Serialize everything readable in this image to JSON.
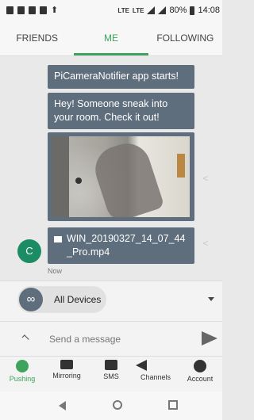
{
  "status_bar": {
    "lte1": "LTE",
    "lte2": "LTE",
    "battery": "80%",
    "time": "14:08"
  },
  "tabs": [
    {
      "label": "FRIENDS",
      "active": false
    },
    {
      "label": "ME",
      "active": true
    },
    {
      "label": "FOLLOWING",
      "active": false
    }
  ],
  "chat": {
    "messages": [
      {
        "text": "PiCameraNotifier app starts!"
      },
      {
        "text": "Hey! Someone sneak into your room. Check it out!"
      },
      {
        "text": ""
      },
      {
        "text": "WIN_20190327_14_07_44_Pro.mp4"
      }
    ],
    "avatar_letter": "C",
    "timestamp": "Now"
  },
  "devices": {
    "label": "All Devices"
  },
  "composer": {
    "placeholder": "Send a message"
  },
  "bottom_nav": [
    {
      "label": "Pushing",
      "active": true
    },
    {
      "label": "Mirroring",
      "active": false
    },
    {
      "label": "SMS",
      "active": false
    },
    {
      "label": "Channels",
      "active": false
    },
    {
      "label": "Account",
      "active": false
    }
  ],
  "colors": {
    "accent": "#3da35d",
    "bubble": "#5f6e7d",
    "avatar": "#1b8c63"
  }
}
